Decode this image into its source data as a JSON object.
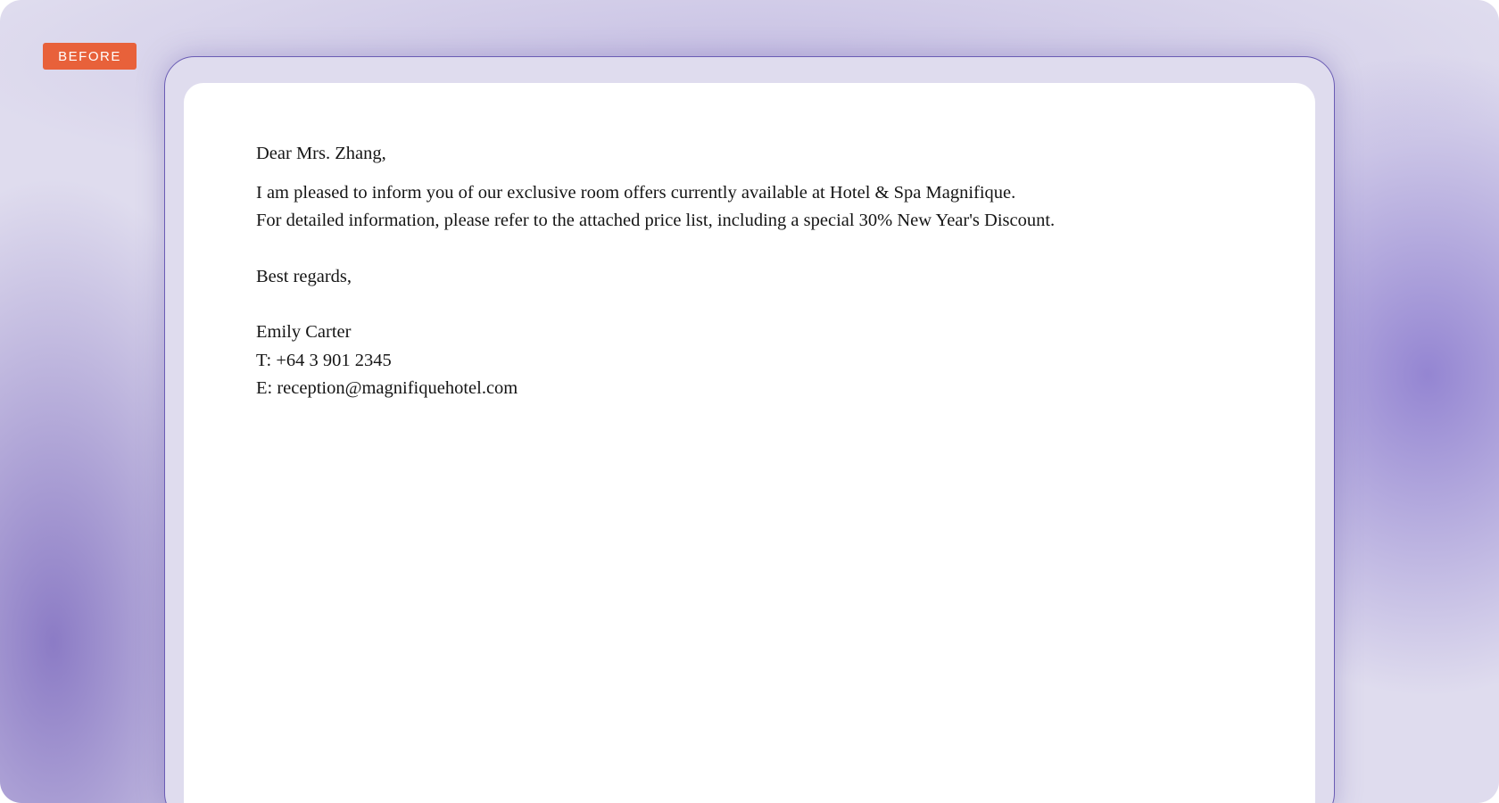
{
  "badge": {
    "label": "BEFORE",
    "color": "#e8613a"
  },
  "email": {
    "greeting": "Dear Mrs. Zhang,",
    "body_lines": [
      "I am pleased to inform you of our exclusive room offers currently available at Hotel & Spa Magnifique.",
      "For detailed information, please refer to the attached price list, including a special 30% New Year's Discount."
    ],
    "closing": "Best regards,",
    "signature": {
      "name": "Emily Carter",
      "phone": "T: +64 3 901 2345",
      "email": "E: reception@magnifiquehotel.com"
    }
  },
  "colors": {
    "background": "#dfdcee",
    "accent": "#6a5cb4",
    "text": "#151515"
  }
}
